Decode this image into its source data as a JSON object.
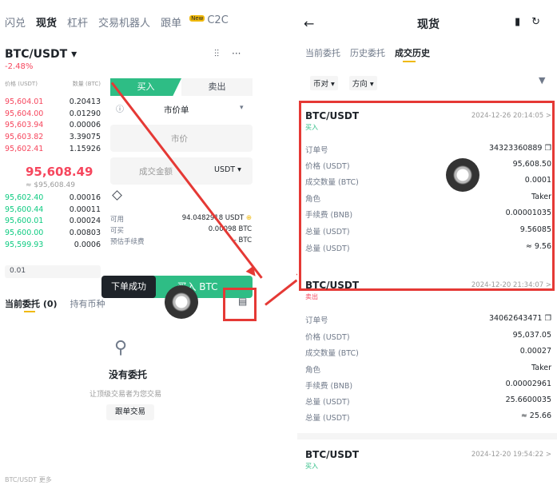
{
  "colors": {
    "buy": "#2ebd85",
    "sell": "#f6465d",
    "highlight": "#e53935",
    "accent": "#f0b90b"
  },
  "left": {
    "top_tabs": [
      "闪兑",
      "现货",
      "杠杆",
      "交易机器人",
      "跟单",
      "C2C"
    ],
    "active_tab": "现货",
    "new_badge": "New",
    "pair": "BTC/USDT ▾",
    "change": "-2.48%",
    "header_icons": [
      "candlestick-icon",
      "more-icon"
    ],
    "ob_head": {
      "price": "价格 (USDT)",
      "qty": "数量 (BTC)"
    },
    "asks": [
      {
        "p": "95,604.01",
        "q": "0.20413"
      },
      {
        "p": "95,604.00",
        "q": "0.01290"
      },
      {
        "p": "95,603.94",
        "q": "0.00006"
      },
      {
        "p": "95,603.82",
        "q": "3.39075"
      },
      {
        "p": "95,602.41",
        "q": "1.15926"
      }
    ],
    "mid_price": "95,608.49",
    "mid_sub": "≈ $95,608.49",
    "bids": [
      {
        "p": "95,602.40",
        "q": "0.00016"
      },
      {
        "p": "95,600.44",
        "q": "0.00011"
      },
      {
        "p": "95,600.01",
        "q": "0.00024"
      },
      {
        "p": "95,600.00",
        "q": "0.00803"
      },
      {
        "p": "95,599.93",
        "q": "0.0006"
      }
    ],
    "ob_foot": "0.01",
    "buy_tab": "买入",
    "sell_tab": "卖出",
    "order_type": "市价单",
    "price_placeholder": "市价",
    "amount_placeholder": "成交金额",
    "amount_unit": "USDT ▾",
    "avail_label": "可用",
    "avail_val": "94.0482918 USDT",
    "buyable_label": "可买",
    "buyable_val": "0.00098 BTC",
    "fee_label": "预估手续费",
    "fee_val": "-- BTC",
    "buy_button": "买入 BTC",
    "toast": "下单成功",
    "bottom_tabs": [
      "当前委托 (0)",
      "持有币种"
    ],
    "empty_title": "没有委托",
    "empty_sub": "让顶级交易者为您交易",
    "follow_button": "跟单交易",
    "bottom_text": "BTC/USDT 更多"
  },
  "right": {
    "title": "现货",
    "tabs": [
      "当前委托",
      "历史委托",
      "成交历史"
    ],
    "active_tab": "成交历史",
    "filters": [
      "币对 ▾",
      "方向 ▾"
    ],
    "cards": [
      {
        "pair": "BTC/USDT",
        "side": "买入",
        "date": "2024-12-26 20:14:05 >",
        "rows": [
          {
            "k": "订单号",
            "v": "34323360889 ❐"
          },
          {
            "k": "价格 (USDT)",
            "v": "95,608.50"
          },
          {
            "k": "成交数量 (BTC)",
            "v": "0.0001"
          },
          {
            "k": "角色",
            "v": "Taker"
          },
          {
            "k": "手续费 (BNB)",
            "v": "0.00001035"
          },
          {
            "k": "总量 (USDT)",
            "v": "9.56085"
          },
          {
            "k": "总量 (USDT)",
            "v": "≈ 9.56"
          }
        ]
      },
      {
        "pair": "BTC/USDT",
        "side": "卖出",
        "date": "2024-12-20 21:34:07 >",
        "rows": [
          {
            "k": "订单号",
            "v": "34062643471 ❐"
          },
          {
            "k": "价格 (USDT)",
            "v": "95,037.05"
          },
          {
            "k": "成交数量 (BTC)",
            "v": "0.00027"
          },
          {
            "k": "角色",
            "v": "Taker"
          },
          {
            "k": "手续费 (BNB)",
            "v": "0.00002961"
          },
          {
            "k": "总量 (USDT)",
            "v": "25.6600035"
          },
          {
            "k": "总量 (USDT)",
            "v": "≈ 25.66"
          }
        ]
      },
      {
        "pair": "BTC/USDT",
        "side": "买入",
        "date": "2024-12-20 19:54:22 >",
        "rows": []
      }
    ]
  }
}
